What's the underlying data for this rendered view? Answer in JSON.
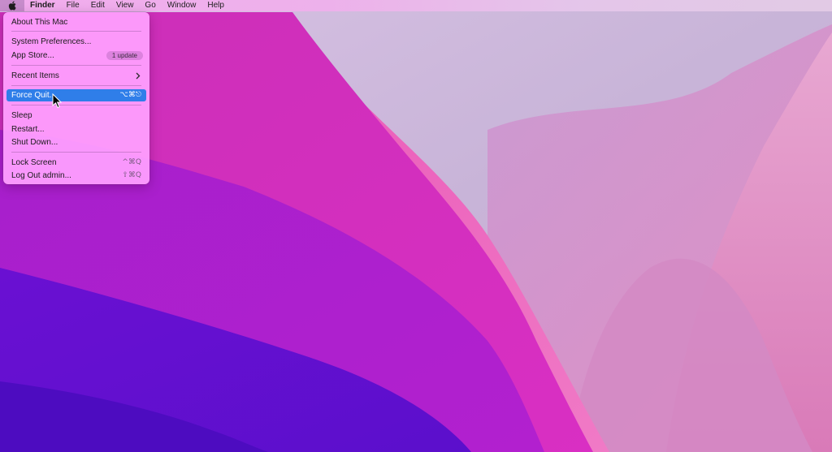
{
  "menubar": {
    "items": [
      "Finder",
      "File",
      "Edit",
      "View",
      "Go",
      "Window",
      "Help"
    ]
  },
  "apple_menu": {
    "about": "About This Mac",
    "system_prefs": "System Preferences...",
    "app_store": "App Store...",
    "app_store_badge": "1 update",
    "recent_items": "Recent Items",
    "force_quit": "Force Quit...",
    "force_quit_shortcut": "⌥⌘⎋",
    "sleep": "Sleep",
    "restart": "Restart...",
    "shut_down": "Shut Down...",
    "lock_screen": "Lock Screen",
    "lock_screen_shortcut": "^⌘Q",
    "log_out": "Log Out admin...",
    "log_out_shortcut": "⇧⌘Q"
  },
  "colors": {
    "highlight": "#2f7ee9",
    "menu_bg": "#ffa0ff"
  },
  "icons": {
    "apple": "apple-logo-icon",
    "submenu": "chevron-right-icon",
    "pointer": "mouse-pointer-icon"
  }
}
